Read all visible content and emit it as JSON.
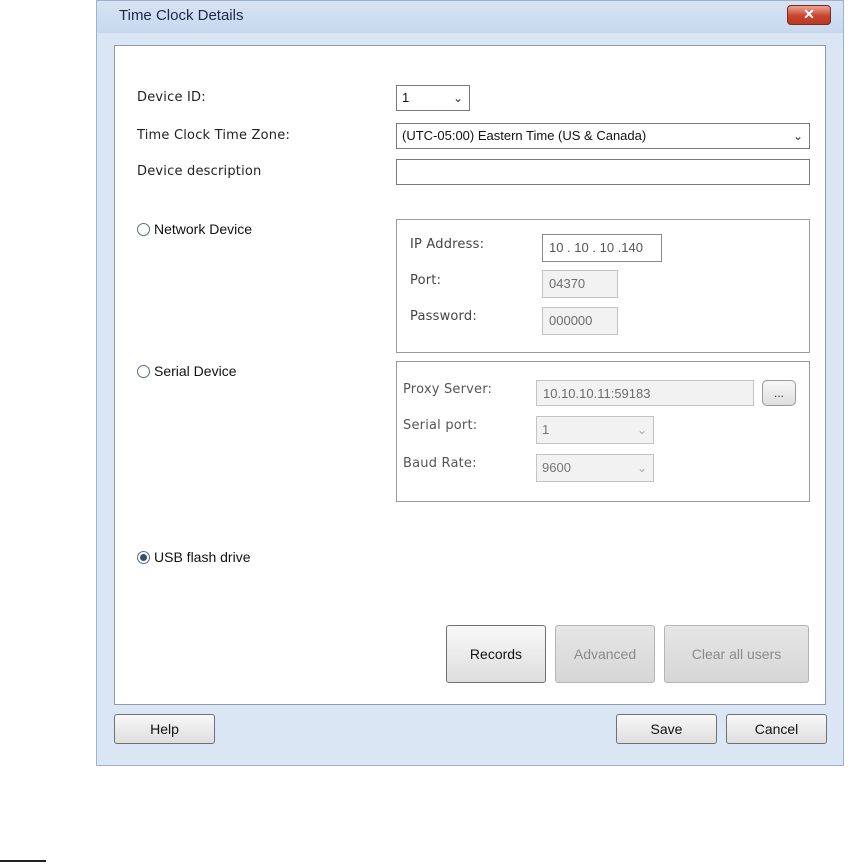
{
  "window": {
    "title": "Time Clock Details"
  },
  "form": {
    "device_id_label": "Device ID:",
    "device_id_value": "1",
    "timezone_label": "Time Clock Time Zone:",
    "timezone_value": "(UTC-05:00) Eastern Time (US & Canada)",
    "description_label": "Device description",
    "description_value": ""
  },
  "network": {
    "radio_label": "Network Device",
    "selected": false,
    "ip_label": "IP Address:",
    "ip_value": "10 . 10 . 10 .140",
    "port_label": "Port:",
    "port_value": "04370",
    "password_label": "Password:",
    "password_value": "000000"
  },
  "serial": {
    "radio_label": "Serial Device",
    "selected": false,
    "proxy_label": "Proxy Server:",
    "proxy_value": "10.10.10.11:59183",
    "browse_label": "...",
    "serial_port_label": "Serial port:",
    "serial_port_value": "1",
    "baud_label": "Baud Rate:",
    "baud_value": "9600"
  },
  "usb": {
    "radio_label": "USB flash drive",
    "selected": true
  },
  "actions": {
    "records": "Records",
    "advanced": "Advanced",
    "clear_users": "Clear all users"
  },
  "footer": {
    "help": "Help",
    "save": "Save",
    "cancel": "Cancel"
  },
  "icons": {
    "close": "close-icon",
    "chevron": "chevron-down-icon"
  },
  "colors": {
    "titlebar": "#c7d8ee",
    "close_button": "#c8452d",
    "frame": "#dbe6f4"
  }
}
